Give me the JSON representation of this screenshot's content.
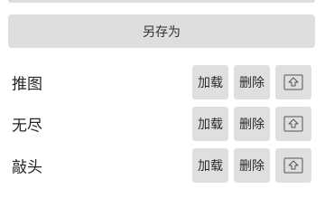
{
  "save_as_label": "另存为",
  "presets": [
    {
      "name": "推图",
      "load_label": "加载",
      "delete_label": "删除",
      "upload_icon": "upload-icon"
    },
    {
      "name": "无尽",
      "load_label": "加载",
      "delete_label": "删除",
      "upload_icon": "upload-icon"
    },
    {
      "name": "敲头",
      "load_label": "加载",
      "delete_label": "删除",
      "upload_icon": "upload-icon"
    }
  ]
}
